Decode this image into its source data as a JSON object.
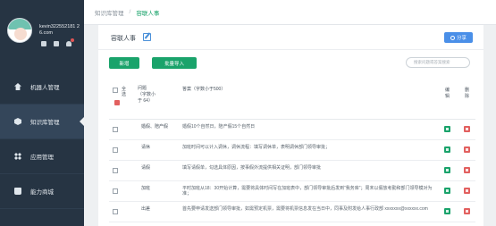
{
  "sidebar": {
    "user": {
      "name": "kevin322552181 26.com"
    },
    "items": [
      {
        "label": "机器人管理",
        "icon": "robot-icon",
        "active": false
      },
      {
        "label": "知识库管理",
        "icon": "knowledge-base-icon",
        "active": true
      },
      {
        "label": "应用管理",
        "icon": "apps-icon",
        "active": false
      },
      {
        "label": "能力商城",
        "icon": "mall-icon",
        "active": false
      }
    ]
  },
  "breadcrumb": {
    "root": "知识库管理",
    "separator": "/",
    "current": "容联人事"
  },
  "card": {
    "title": "容联人事",
    "share_label": "分享",
    "add_label": "新增",
    "import_label": "批量导入",
    "search_placeholder": "搜索问题或答案搜索"
  },
  "table": {
    "headers": {
      "all": "全选",
      "question": "问题 （字数小于 64）",
      "answer": "答案（字数小于500）",
      "edit": "编辑",
      "delete": "删除"
    },
    "rows": [
      {
        "question": "婚假、陪产假",
        "answer": "婚假10个自然日，陪产假15个自然日"
      },
      {
        "question": "请休",
        "answer": "加班时间可以计入调休，调休流程：填写调休单，表明调休部门领导审批；"
      },
      {
        "question": "请假",
        "answer": "填写请假单，勾选具体原因，按事假外流提供相关证明，部门领导审批"
      },
      {
        "question": "加班",
        "answer": "平时加班从18：30开始计算，需要将具体时间写在加班表中，部门领导审批后发到“我务库”；周末以假放考勤和部门领导模对为准；"
      },
      {
        "question": "出差",
        "answer": "首先要申请发送部门领导审批，如需预定机票，需要将机票信息发在当日中，同事及附发给人事行政部 xxxxxxx@xxxxxx.com"
      }
    ]
  },
  "colors": {
    "accent": "#1aa36b",
    "share": "#4a8fe8",
    "danger": "#e2605f",
    "sidebar_bg": "#263443"
  }
}
